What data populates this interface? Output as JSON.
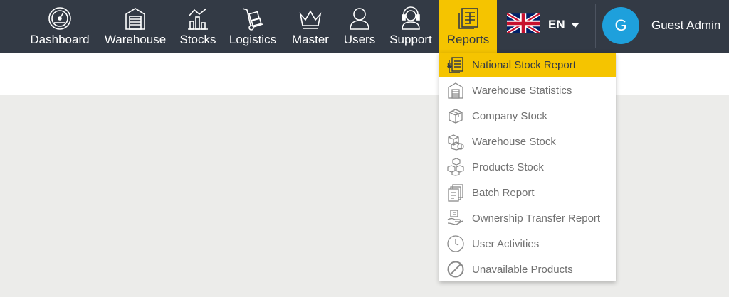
{
  "nav": {
    "items": [
      {
        "label": "Dashboard",
        "icon": "dashboard-gauge-icon"
      },
      {
        "label": "Warehouse",
        "icon": "warehouse-icon"
      },
      {
        "label": "Stocks",
        "icon": "stocks-chart-icon"
      },
      {
        "label": "Logistics",
        "icon": "hand-truck-icon"
      },
      {
        "label": "Master",
        "icon": "crown-icon"
      },
      {
        "label": "Users",
        "icon": "user-icon"
      },
      {
        "label": "Support",
        "icon": "headset-icon"
      },
      {
        "label": "Reports",
        "icon": "reports-icon",
        "active": true
      }
    ]
  },
  "language": {
    "code": "EN",
    "flag": "uk-flag-icon"
  },
  "user": {
    "initial": "G",
    "name": "Guest Admin",
    "avatar_color": "#1ea0dc"
  },
  "reports_menu": {
    "items": [
      {
        "label": "National Stock Report",
        "icon": "national-report-icon",
        "active": true
      },
      {
        "label": "Warehouse Statistics",
        "icon": "warehouse-statistics-icon"
      },
      {
        "label": "Company Stock",
        "icon": "box-icon"
      },
      {
        "label": "Warehouse Stock",
        "icon": "boxes-icon"
      },
      {
        "label": "Products Stock",
        "icon": "products-icon"
      },
      {
        "label": "Batch Report",
        "icon": "documents-icon"
      },
      {
        "label": "Ownership Transfer Report",
        "icon": "transfer-icon"
      },
      {
        "label": "User Activities",
        "icon": "clock-icon"
      },
      {
        "label": "Unavailable Products",
        "icon": "prohibited-icon"
      }
    ]
  },
  "colors": {
    "topbar": "#333a45",
    "accent": "#f5c400",
    "content_bg": "#ececea",
    "menu_text": "#707070"
  }
}
